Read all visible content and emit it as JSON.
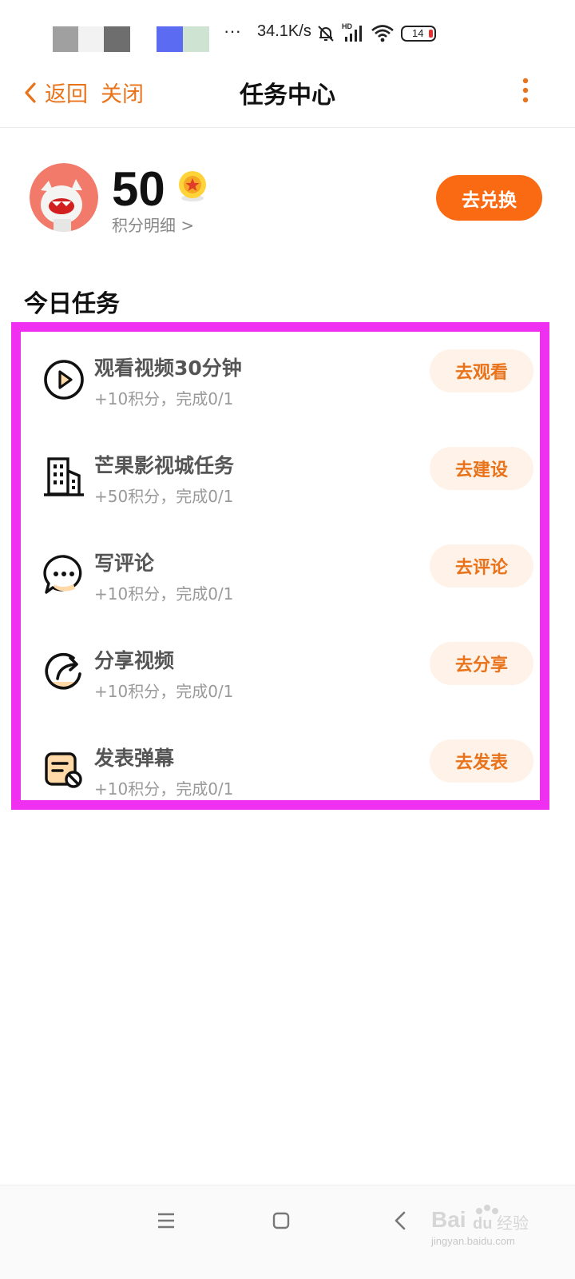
{
  "status_bar": {
    "dots": "···",
    "net_speed": "34.1K/s",
    "hd_label": "HD",
    "battery": "14",
    "blocks": [
      "#a0a0a0",
      "#f2f2f2",
      "#6e6e6e",
      "#5b6cf2",
      "#cfe3d2"
    ],
    "icons": [
      "mute-bell-icon",
      "signal-icon",
      "wifi-icon",
      "battery-icon"
    ]
  },
  "header": {
    "back_label": "返回",
    "close_label": "关闭",
    "title": "任务中心"
  },
  "profile": {
    "points": "50",
    "points_detail": "积分明细 >",
    "redeem_label": "去兑换"
  },
  "today": {
    "section_title": "今日任务",
    "tasks": [
      {
        "icon": "play-icon",
        "title": "观看视频30分钟",
        "reward": "+10积分，完成0/1",
        "action": "去观看"
      },
      {
        "icon": "building-icon",
        "title": "芒果影视城任务",
        "reward": "+50积分，完成0/1",
        "action": "去建设"
      },
      {
        "icon": "comment-icon",
        "title": "写评论",
        "reward": "+10积分，完成0/1",
        "action": "去评论"
      },
      {
        "icon": "share-icon",
        "title": "分享视频",
        "reward": "+10积分，完成0/1",
        "action": "去分享"
      },
      {
        "icon": "danmaku-icon",
        "title": "发表弹幕",
        "reward": "+10积分，完成0/1",
        "action": "去发表"
      }
    ]
  },
  "nav": {
    "icons": [
      "menu-icon",
      "home-icon",
      "back-icon"
    ]
  },
  "watermark": {
    "logo": "Bai du 经验",
    "url": "jingyan.baidu.com"
  },
  "colors": {
    "accent": "#fa6a12",
    "accent_text": "#e8731a",
    "highlight_border": "#f030f0",
    "task_button_bg": "#fff2e8"
  }
}
